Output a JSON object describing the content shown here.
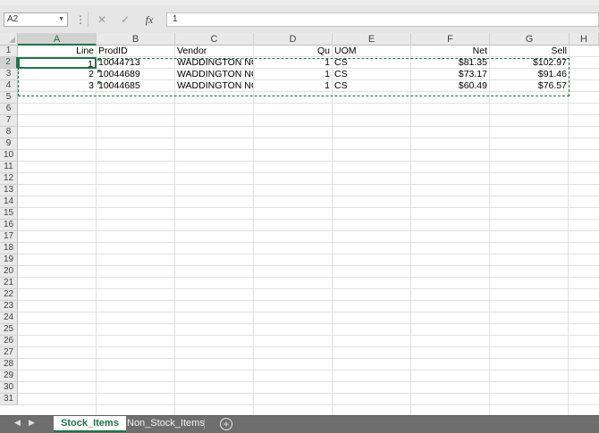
{
  "formula_bar": {
    "name_box": "A2",
    "formula": "1",
    "icons": [
      "more-icon",
      "cancel-icon",
      "enter-icon",
      "function-icon"
    ]
  },
  "columns": [
    "A",
    "B",
    "C",
    "D",
    "E",
    "F",
    "G",
    "H"
  ],
  "rows": [
    "1",
    "2",
    "3",
    "4",
    "5",
    "6",
    "7",
    "8",
    "9",
    "10",
    "11",
    "12",
    "13",
    "14",
    "15",
    "16",
    "17",
    "18",
    "19",
    "20",
    "21",
    "22",
    "23",
    "24",
    "25",
    "26",
    "27",
    "28",
    "29",
    "30",
    "31"
  ],
  "table": {
    "headers": [
      "Line",
      "ProdID",
      "Vendor",
      "Qu",
      "UOM",
      "Net",
      "Sell"
    ],
    "rows": [
      [
        "1",
        "10044713",
        "WADDINGTON NOF",
        "1",
        "CS",
        "$81.35",
        "$102.97"
      ],
      [
        "2",
        "10044689",
        "WADDINGTON NOF",
        "1",
        "CS",
        "$73.17",
        "$91.46"
      ],
      [
        "3",
        "10044685",
        "WADDINGTON NOF",
        "1",
        "CS",
        "$60.49",
        "$76.57"
      ]
    ]
  },
  "sheet_tabs": [
    {
      "label": "Stock_Items",
      "active": true
    },
    {
      "label": "Non_Stock_Items",
      "active": false
    }
  ],
  "add_sheet_symbol": "+",
  "colors": {
    "accent": "#217346",
    "tab_bar": "#6e6e6e"
  }
}
